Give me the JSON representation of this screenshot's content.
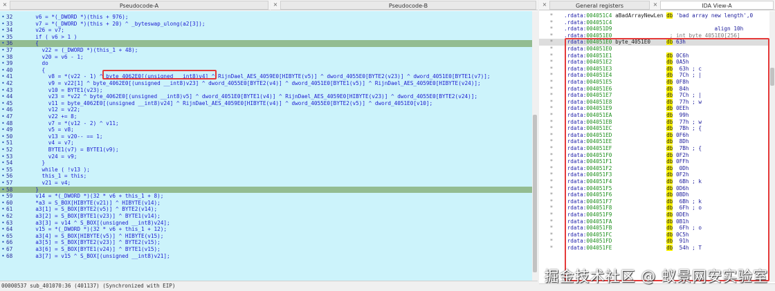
{
  "tabs": {
    "pseudo_a": "Pseudocode-A",
    "pseudo_b": "Pseudocode-B",
    "general_registers": "General registers",
    "ida_view": "IDA View-A",
    "close_glyph": "×"
  },
  "pseudocode": [
    {
      "n": "32",
      "code": "  v6 = *(_DWORD *)(this + 976);"
    },
    {
      "n": "33",
      "code": "  v7 = *(_DWORD *)(this + 20) ^ _byteswap_ulong(a2[3]);"
    },
    {
      "n": "34",
      "code": "  v26 = v7;"
    },
    {
      "n": "35",
      "code": "  if ( v6 > 1 )"
    },
    {
      "n": "36",
      "code": "  {",
      "hl": true
    },
    {
      "n": "37",
      "code": "    v22 = (_DWORD *)(this_1 + 48);"
    },
    {
      "n": "38",
      "code": "    v20 = v6 - 1;"
    },
    {
      "n": "39",
      "code": "    do"
    },
    {
      "n": "40",
      "code": "    {"
    },
    {
      "n": "41",
      "code": "      v8 = *(v22 - 1) ^ byte_4062E0[(unsigned __int8)v4] ^ RijnDael_AES_4059E0[HIBYTE(v5)] ^ dword_4055E0[BYTE2(v23)] ^ dword_4051E0[BYTE1(v7)];"
    },
    {
      "n": "42",
      "code": "      v9 = v22[1] ^ byte_4062E0[(unsigned __int8)v23] ^ dword_4055E0[BYTE2(v4)] ^ dword_4051E0[BYTE1(v5)] ^ RijnDael_AES_4059E0[HIBYTE(v24)];"
    },
    {
      "n": "43",
      "code": "      v10 = BYTE1(v23);"
    },
    {
      "n": "44",
      "code": "      v23 = *v22 ^ byte_4062E0[(unsigned __int8)v5] ^ dword_4051E0[BYTE1(v4)] ^ RijnDael_AES_4059E0[HIBYTE(v23)] ^ dword_4055E0[BYTE2(v24)];"
    },
    {
      "n": "45",
      "code": "      v11 = byte_4062E0[(unsigned __int8)v24] ^ RijnDael_AES_4059E0[HIBYTE(v4)] ^ dword_4055E0[BYTE2(v5)] ^ dword_4051E0[v10];"
    },
    {
      "n": "46",
      "code": "      v12 = v22;"
    },
    {
      "n": "47",
      "code": "      v22 += 8;"
    },
    {
      "n": "48",
      "code": "      v7 = *(v12 - 2) ^ v11;"
    },
    {
      "n": "49",
      "code": "      v5 = v8;"
    },
    {
      "n": "50",
      "code": "      v13 = v20-- == 1;"
    },
    {
      "n": "51",
      "code": "      v4 = v7;"
    },
    {
      "n": "52",
      "code": "      BYTE1(v7) = BYTE1(v9);"
    },
    {
      "n": "53",
      "code": "      v24 = v9;"
    },
    {
      "n": "54",
      "code": "    }"
    },
    {
      "n": "55",
      "code": "    while ( !v13 );"
    },
    {
      "n": "56",
      "code": "    this_1 = this;"
    },
    {
      "n": "57",
      "code": "    v21 = v4;"
    },
    {
      "n": "58",
      "code": "  }",
      "hl": true
    },
    {
      "n": "59",
      "code": "  v14 = *(_DWORD *)(32 * v6 + this_1 + 8);"
    },
    {
      "n": "60",
      "code": "  *a3 = S_BOX[HIBYTE(v21)] ^ HIBYTE(v14);"
    },
    {
      "n": "61",
      "code": "  a3[1] = S_BOX[BYTE2(v5)] ^ BYTE2(v14);"
    },
    {
      "n": "62",
      "code": "  a3[2] = S_BOX[BYTE1(v23)] ^ BYTE1(v14);"
    },
    {
      "n": "63",
      "code": "  a3[3] = v14 ^ S_BOX[(unsigned __int8)v24];"
    },
    {
      "n": "64",
      "code": "  v15 = *(_DWORD *)(32 * v6 + this_1 + 12);"
    },
    {
      "n": "65",
      "code": "  a3[4] = S_BOX[HIBYTE(v5)] ^ HIBYTE(v15);"
    },
    {
      "n": "66",
      "code": "  a3[5] = S_BOX[BYTE2(v23)] ^ BYTE2(v15);"
    },
    {
      "n": "67",
      "code": "  a3[6] = S_BOX[BYTE1(v24)] ^ BYTE1(v15);"
    },
    {
      "n": "68",
      "code": "  a3[7] = v15 ^ S_BOX[(unsigned __int8)v21];"
    }
  ],
  "status_line": "00000537 sub_401070:36 (401137) (Synchronized with EIP)",
  "ida": [
    {
      "seg": ".rdata:",
      "addr": "004051C4",
      "name": " aBadArrayNewLen ",
      "db": "db",
      "val": " 'bad array new length',0"
    },
    {
      "seg": ".rdata:",
      "addr": "004051C4",
      "name": "",
      "db": "",
      "val": ""
    },
    {
      "seg": ".rdata:",
      "addr": "004051D9",
      "name": "",
      "db": "",
      "val": "               align 10h"
    },
    {
      "seg": ".rdata:",
      "addr": "004051E0",
      "name": "",
      "db": "",
      "val": " ; int byte_4051E0[256]",
      "cmt": true
    },
    {
      "seg": ".rdata:",
      "addr": "004051E0",
      "name": " byte_4051E0     ",
      "db": "db",
      "val": " 63h",
      "sel": true
    },
    {
      "seg": ".rdata:",
      "addr": "004051E0",
      "name": "",
      "db": "",
      "val": ""
    },
    {
      "seg": ".rdata:",
      "addr": "004051E1",
      "name": "",
      "db": "db",
      "val": " 0C6h"
    },
    {
      "seg": ".rdata:",
      "addr": "004051E2",
      "name": "",
      "db": "db",
      "val": " 0A5h"
    },
    {
      "seg": ".rdata:",
      "addr": "004051E3",
      "name": "",
      "db": "db",
      "val": "  63h ; c"
    },
    {
      "seg": ".rdata:",
      "addr": "004051E4",
      "name": "",
      "db": "db",
      "val": "  7Ch ; |"
    },
    {
      "seg": ".rdata:",
      "addr": "004051E5",
      "name": "",
      "db": "db",
      "val": " 0F8h"
    },
    {
      "seg": ".rdata:",
      "addr": "004051E6",
      "name": "",
      "db": "db",
      "val": "  84h"
    },
    {
      "seg": ".rdata:",
      "addr": "004051E7",
      "name": "",
      "db": "db",
      "val": "  7Ch ; |"
    },
    {
      "seg": ".rdata:",
      "addr": "004051E8",
      "name": "",
      "db": "db",
      "val": "  77h ; w"
    },
    {
      "seg": ".rdata:",
      "addr": "004051E9",
      "name": "",
      "db": "db",
      "val": " 0EEh"
    },
    {
      "seg": ".rdata:",
      "addr": "004051EA",
      "name": "",
      "db": "db",
      "val": "  99h"
    },
    {
      "seg": ".rdata:",
      "addr": "004051EB",
      "name": "",
      "db": "db",
      "val": "  77h ; w"
    },
    {
      "seg": ".rdata:",
      "addr": "004051EC",
      "name": "",
      "db": "db",
      "val": "  7Bh ; {"
    },
    {
      "seg": ".rdata:",
      "addr": "004051ED",
      "name": "",
      "db": "db",
      "val": " 0F6h"
    },
    {
      "seg": ".rdata:",
      "addr": "004051EE",
      "name": "",
      "db": "db",
      "val": "  8Dh"
    },
    {
      "seg": ".rdata:",
      "addr": "004051EF",
      "name": "",
      "db": "db",
      "val": "  7Bh ; {"
    },
    {
      "seg": ".rdata:",
      "addr": "004051F0",
      "name": "",
      "db": "db",
      "val": " 0F2h"
    },
    {
      "seg": ".rdata:",
      "addr": "004051F1",
      "name": "",
      "db": "db",
      "val": " 0FFh"
    },
    {
      "seg": ".rdata:",
      "addr": "004051F2",
      "name": "",
      "db": "db",
      "val": "  0Dh"
    },
    {
      "seg": ".rdata:",
      "addr": "004051F3",
      "name": "",
      "db": "db",
      "val": " 0F2h"
    },
    {
      "seg": ".rdata:",
      "addr": "004051F4",
      "name": "",
      "db": "db",
      "val": "  6Bh ; k"
    },
    {
      "seg": ".rdata:",
      "addr": "004051F5",
      "name": "",
      "db": "db",
      "val": " 0D6h"
    },
    {
      "seg": ".rdata:",
      "addr": "004051F6",
      "name": "",
      "db": "db",
      "val": " 0BDh"
    },
    {
      "seg": ".rdata:",
      "addr": "004051F7",
      "name": "",
      "db": "db",
      "val": "  6Bh ; k"
    },
    {
      "seg": ".rdata:",
      "addr": "004051F8",
      "name": "",
      "db": "db",
      "val": "  6Fh ; o"
    },
    {
      "seg": ".rdata:",
      "addr": "004051F9",
      "name": "",
      "db": "db",
      "val": " 0DEh"
    },
    {
      "seg": ".rdata:",
      "addr": "004051FA",
      "name": "",
      "db": "db",
      "val": " 0B1h"
    },
    {
      "seg": ".rdata:",
      "addr": "004051FB",
      "name": "",
      "db": "db",
      "val": "  6Fh ; o"
    },
    {
      "seg": ".rdata:",
      "addr": "004051FC",
      "name": "",
      "db": "db",
      "val": " 0C5h"
    },
    {
      "seg": ".rdata:",
      "addr": "004051FD",
      "name": "",
      "db": "db",
      "val": "  91h"
    },
    {
      "seg": ".rdata:",
      "addr": "004051FE",
      "name": "",
      "db": "db",
      "val": "  54h ; T"
    }
  ],
  "watermark": "掘金技术社区 @ 蚁景网安实验室"
}
